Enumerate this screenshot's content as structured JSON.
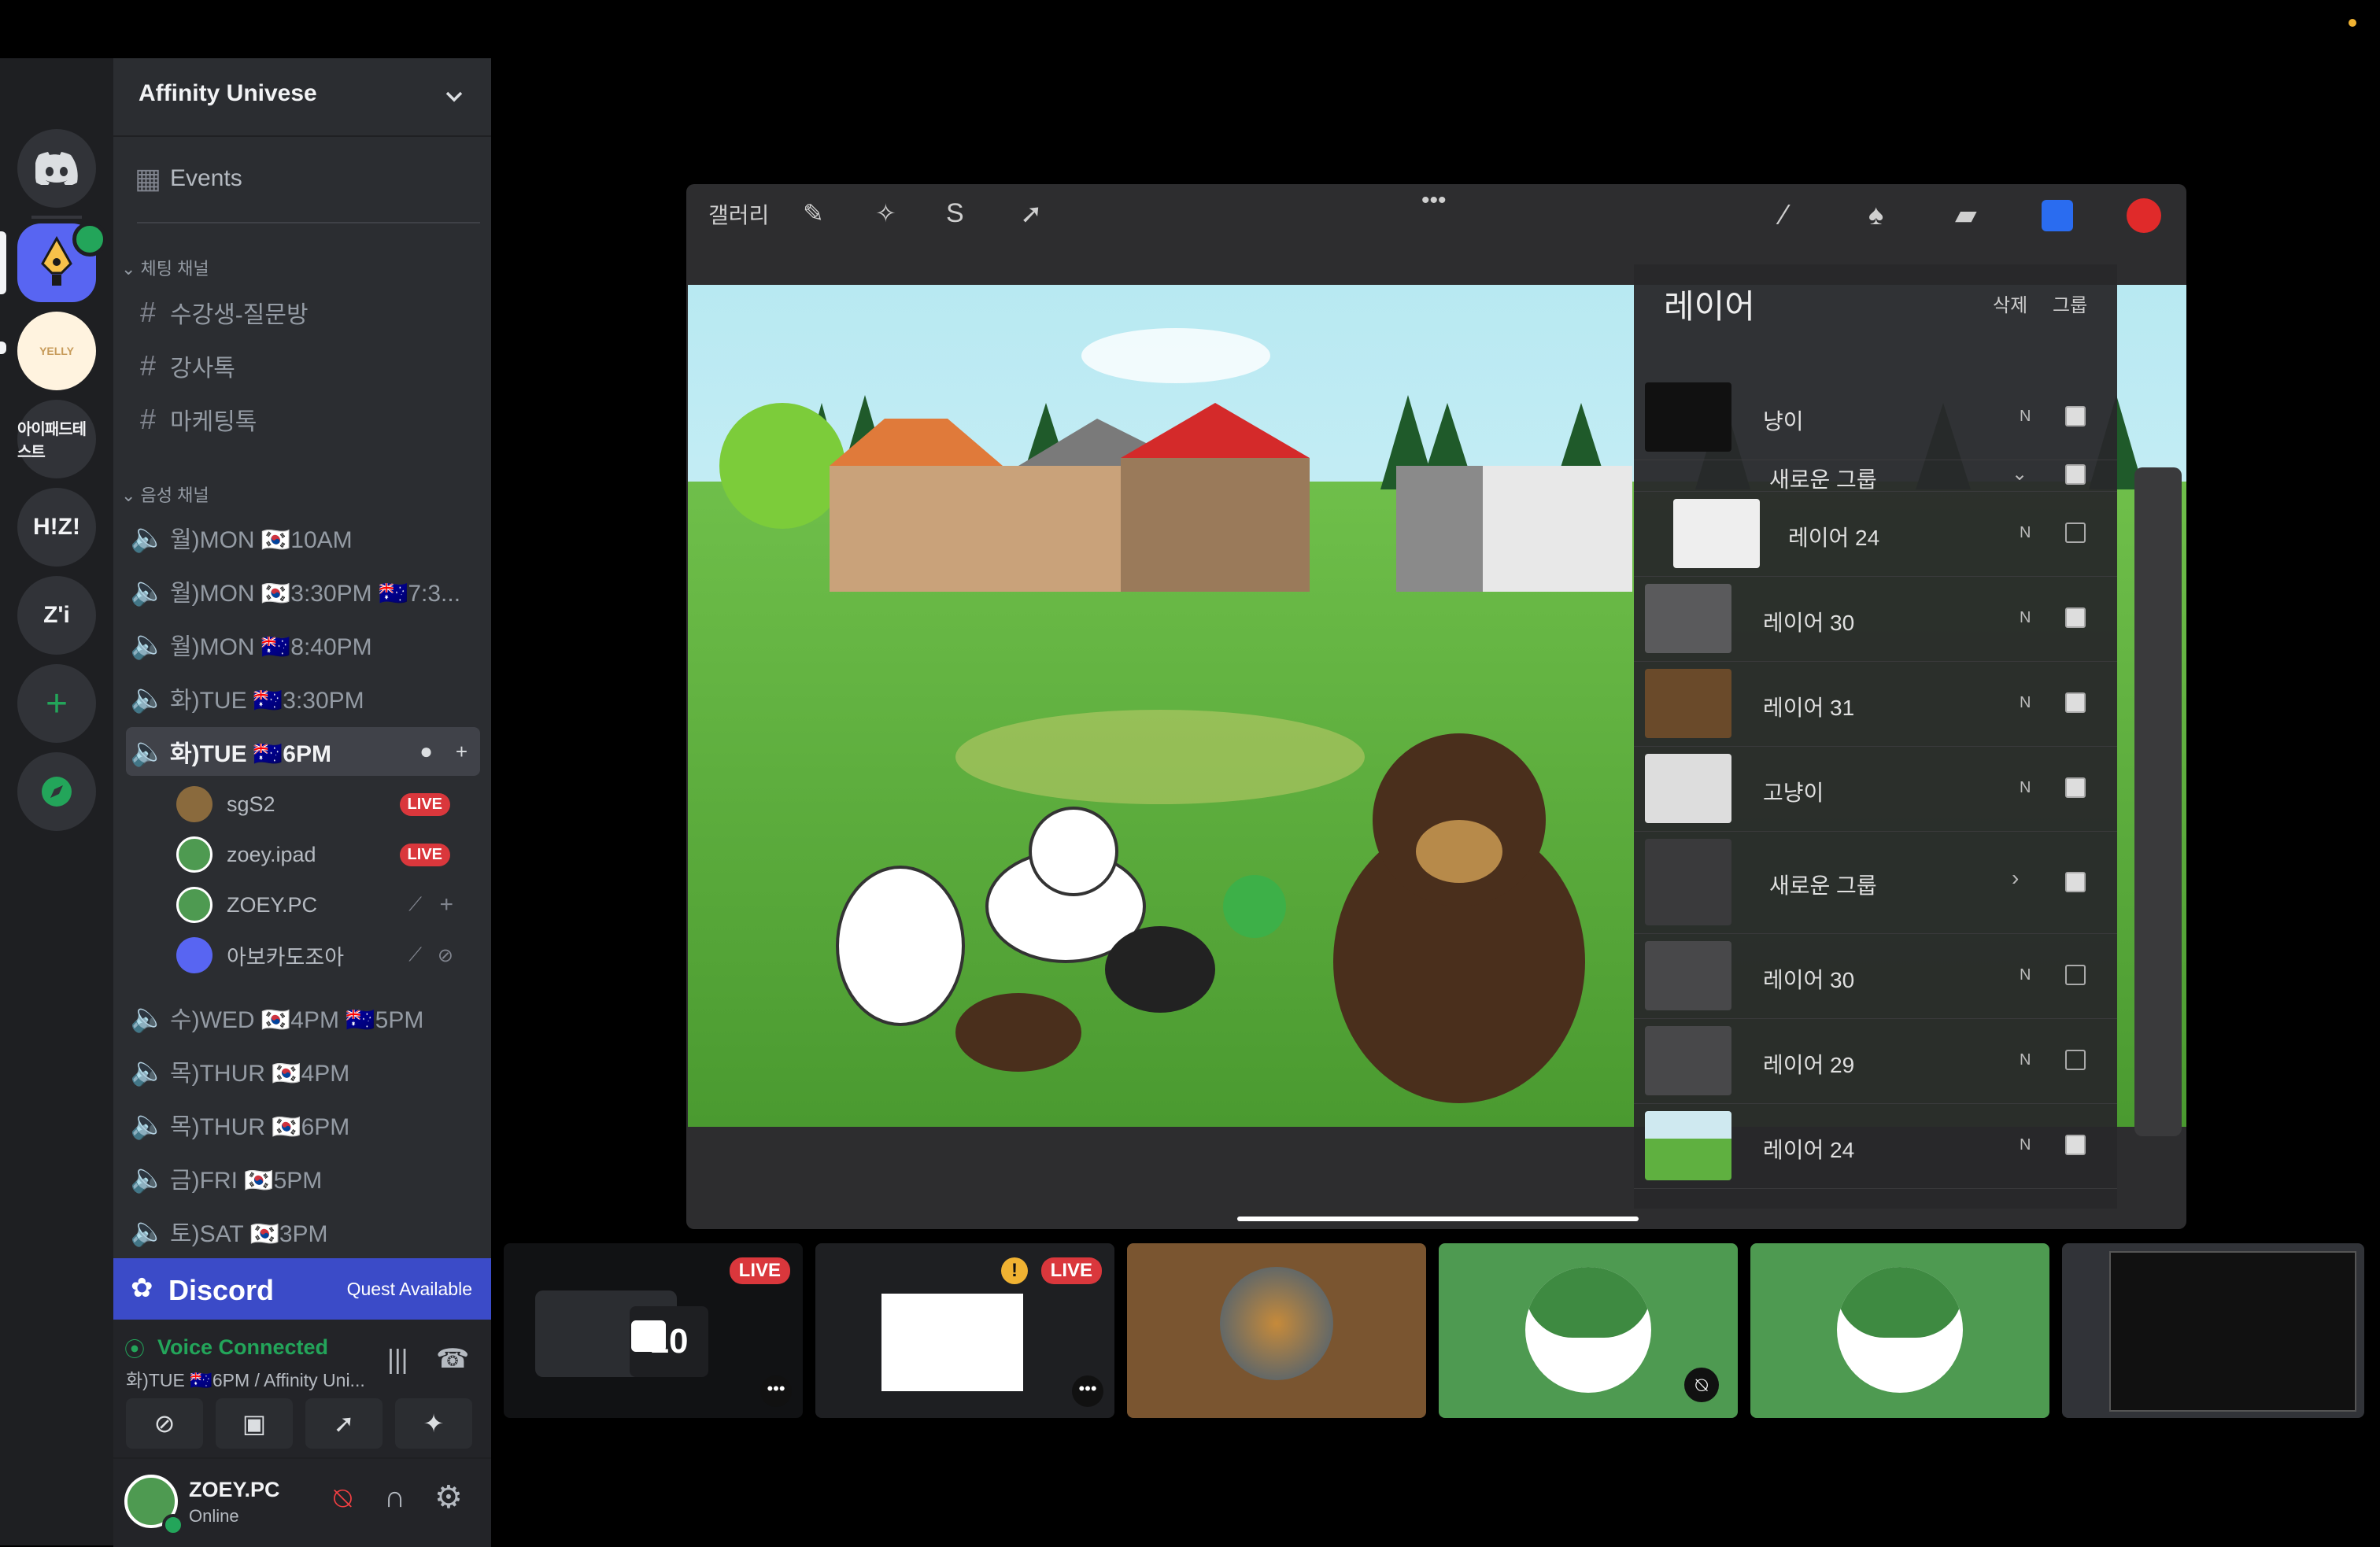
{
  "server": {
    "name": "Affinity Univese",
    "dropdown_icon": "chevron-down-icon"
  },
  "rail": {
    "items": [
      {
        "name": "discord-home",
        "label": ""
      },
      {
        "name": "affinity-server",
        "label": ""
      },
      {
        "name": "yelly-server",
        "label": "YELLY"
      },
      {
        "name": "ipad-test-server",
        "label": "아이패드테스트"
      },
      {
        "name": "hiz-server",
        "label": "H!Z!"
      },
      {
        "name": "zi-server",
        "label": "Z'i"
      },
      {
        "name": "add-server",
        "label": "+"
      },
      {
        "name": "explore",
        "label": ""
      }
    ]
  },
  "sidebar": {
    "events_label": "Events",
    "cat_text": "체팅 채널",
    "cat_voice": "음성 채널",
    "text_channels": [
      "수강생-질문방",
      "강사톡",
      "마케팅톡"
    ],
    "voice_channels": [
      "월)MON 🇰🇷10AM",
      "월)MON 🇰🇷3:30PM 🇦🇺7:3...",
      "월)MON 🇦🇺8:40PM",
      "화)TUE 🇦🇺3:30PM",
      "화)TUE 🇦🇺6PM",
      "수)WED 🇰🇷4PM 🇦🇺5PM",
      "목)THUR 🇰🇷4PM",
      "목)THUR 🇰🇷6PM",
      "금)FRI 🇰🇷5PM",
      "토)SAT 🇰🇷3PM"
    ],
    "voice_users": [
      {
        "name": "sgS2",
        "live": "LIVE"
      },
      {
        "name": "zoey.ipad",
        "live": "LIVE"
      },
      {
        "name": "ZOEY.PC",
        "live": ""
      },
      {
        "name": "아보카도조아",
        "live": ""
      }
    ]
  },
  "quest": {
    "brand": "Discord",
    "label": "Quest Available"
  },
  "voice": {
    "status": "Voice Connected",
    "channel": "화)TUE 🇦🇺6PM / Affinity Uni..."
  },
  "user": {
    "name": "ZOEY.PC",
    "status": "Online"
  },
  "procreate": {
    "gallery": "갤러리",
    "layers_title": "레이어",
    "delete": "삭제",
    "group": "그룹",
    "layers": [
      {
        "name": "냥이",
        "mode": "N",
        "visible": true
      },
      {
        "name": "새로운 그룹",
        "mode": "",
        "visible": true
      },
      {
        "name": "레이어 24",
        "mode": "N",
        "visible": false
      },
      {
        "name": "레이어 30",
        "mode": "N",
        "visible": true
      },
      {
        "name": "레이어 31",
        "mode": "N",
        "visible": true
      },
      {
        "name": "고냥이",
        "mode": "N",
        "visible": true
      },
      {
        "name": "새로운 그룹",
        "mode": "",
        "visible": true
      },
      {
        "name": "레이어 30",
        "mode": "N",
        "visible": false
      },
      {
        "name": "레이어 29",
        "mode": "N",
        "visible": false
      },
      {
        "name": "레이어 24",
        "mode": "N",
        "visible": true
      }
    ]
  },
  "tiles": [
    {
      "live": "LIVE",
      "timer": "10"
    },
    {
      "live": "LIVE",
      "warning": "!"
    },
    {
      "live": ""
    },
    {
      "live": ""
    },
    {
      "live": ""
    },
    {
      "live": ""
    }
  ],
  "colors": {
    "accent": "#5865f2",
    "live": "#da373c",
    "green": "#23a55a",
    "tile_green": "#4e9a51",
    "tile_brown": "#7a5530"
  }
}
